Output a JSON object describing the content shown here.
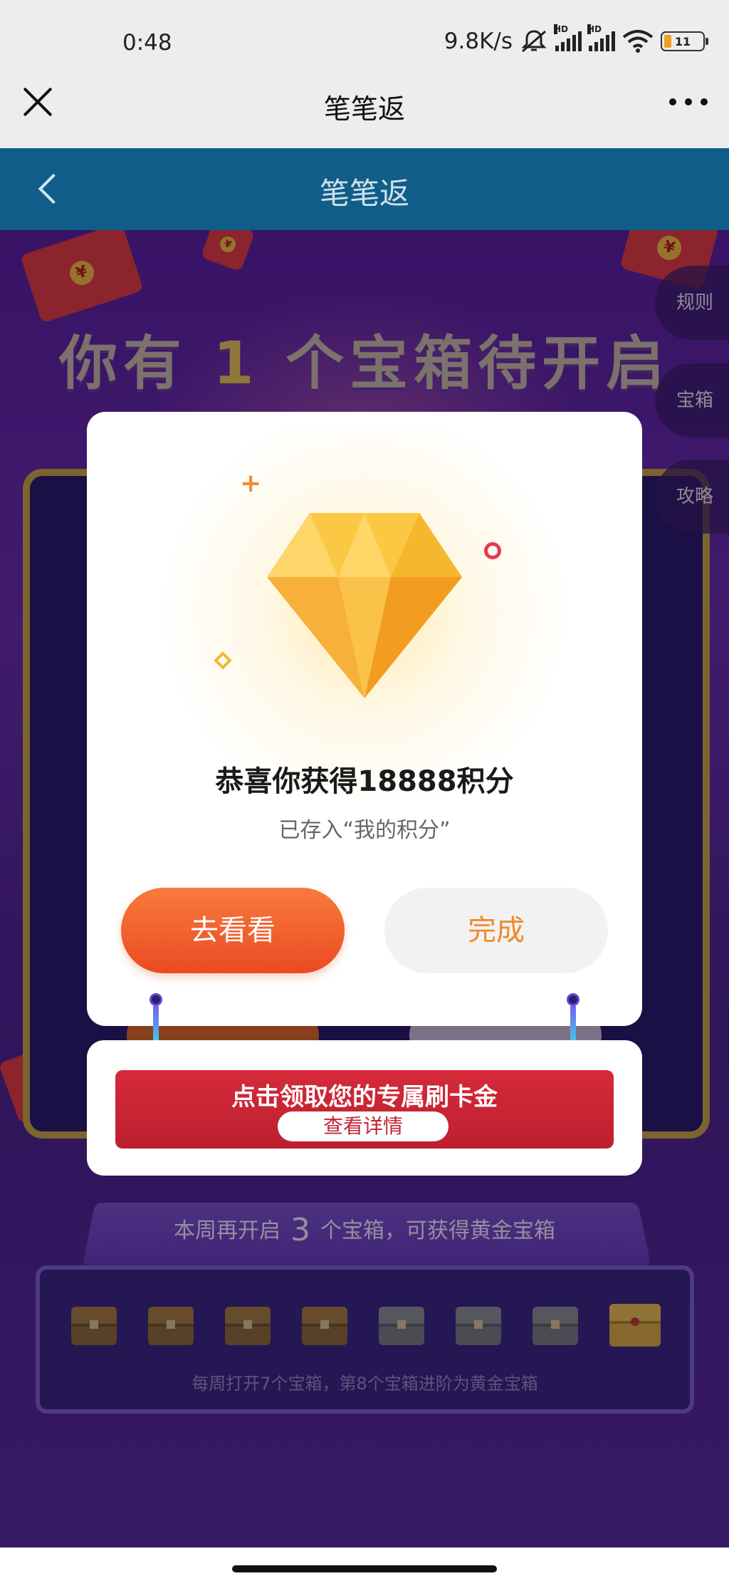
{
  "status_bar": {
    "time": "0:48",
    "net_speed": "9.8K/s",
    "hd_badge": "HD",
    "battery": "11"
  },
  "wechat_nav": {
    "title": "笔笔返"
  },
  "page_header": {
    "title": "笔笔返"
  },
  "headline": {
    "prefix": "你有",
    "count": "1",
    "suffix": "个宝箱待开启"
  },
  "side_menu": {
    "rules": "规则",
    "chest": "宝箱",
    "guide": "攻略"
  },
  "modal": {
    "title": "恭喜你获得18888积分",
    "subtitle": "已存入“我的积分”",
    "go_button": "去看看",
    "done_button": "完成"
  },
  "banner": {
    "main_text": "点击领取您的专属刷卡金",
    "detail_button": "查看详情"
  },
  "weekly": {
    "prefix": "本周再开启",
    "count": "3",
    "suffix": "个宝箱，可获得黄金宝箱",
    "note": "每周打开7个宝箱，第8个宝箱进阶为黄金宝箱",
    "chests_opened": 4,
    "chests_total": 7
  },
  "colors": {
    "header_blue": "#0f5d88",
    "accent_orange": "#ea4b22",
    "banner_red": "#c52433",
    "gold": "#c7a24a"
  }
}
